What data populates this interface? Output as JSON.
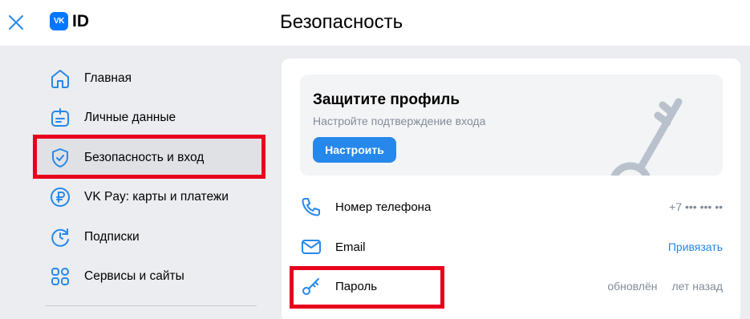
{
  "header": {
    "logo_badge": "VK",
    "logo_text": "ID",
    "page_title": "Безопасность"
  },
  "sidebar": {
    "items": [
      {
        "label": "Главная",
        "icon": "home-icon"
      },
      {
        "label": "Личные данные",
        "icon": "id-card-icon"
      },
      {
        "label": "Безопасность и вход",
        "icon": "shield-check-icon",
        "active": true
      },
      {
        "label": "VK Pay: карты и платежи",
        "icon": "ruble-icon"
      },
      {
        "label": "Подписки",
        "icon": "subscription-clock-icon"
      },
      {
        "label": "Сервисы и сайты",
        "icon": "services-grid-icon"
      }
    ]
  },
  "promo": {
    "title": "Защитите профиль",
    "subtitle": "Настройте подтверждение входа",
    "button": "Настроить"
  },
  "settings": {
    "rows": [
      {
        "label": "Номер телефона",
        "value": "+7 ••• ••• ••",
        "icon": "phone-icon"
      },
      {
        "label": "Email",
        "value": "Привязать",
        "icon": "mail-icon"
      },
      {
        "label": "Пароль",
        "value": "обновлён",
        "value2": "лет назад",
        "icon": "key-icon"
      }
    ]
  },
  "colors": {
    "accent": "#2688eb",
    "brand": "#0077ff",
    "highlight_frame": "#e8001c",
    "background": "#ebedf0"
  }
}
